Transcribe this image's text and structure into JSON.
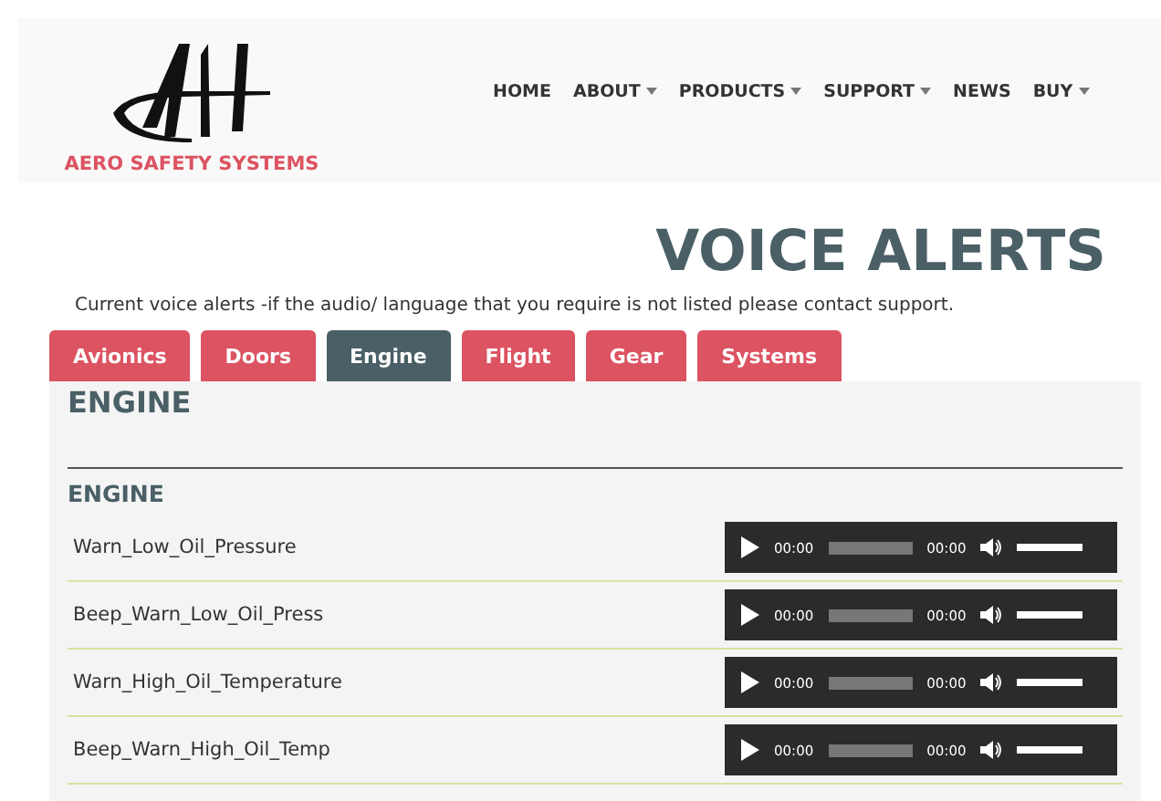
{
  "brand": {
    "name": "AERO SAFETY SYSTEMS"
  },
  "nav": [
    {
      "label": "HOME",
      "dropdown": false
    },
    {
      "label": "ABOUT",
      "dropdown": true
    },
    {
      "label": "PRODUCTS",
      "dropdown": true
    },
    {
      "label": "SUPPORT",
      "dropdown": true
    },
    {
      "label": "NEWS",
      "dropdown": false
    },
    {
      "label": "BUY",
      "dropdown": true
    }
  ],
  "page": {
    "title": "VOICE ALERTS",
    "intro": "Current voice alerts -if the audio/ language that you require is not listed please contact support."
  },
  "tabs": [
    {
      "label": "Avionics",
      "selected": false
    },
    {
      "label": "Doors",
      "selected": false
    },
    {
      "label": "Engine",
      "selected": true
    },
    {
      "label": "Flight",
      "selected": false
    },
    {
      "label": "Gear",
      "selected": false
    },
    {
      "label": "Systems",
      "selected": false
    }
  ],
  "panel": {
    "heading": "ENGINE",
    "section": "ENGINE",
    "alerts": [
      {
        "name": "Warn_Low_Oil_Pressure",
        "current": "00:00",
        "progress": {
          "level": 0
        },
        "duration": "00:00",
        "volume": {
          "level": 1
        }
      },
      {
        "name": "Beep_Warn_Low_Oil_Press",
        "current": "00:00",
        "progress": {
          "level": 0
        },
        "duration": "00:00",
        "volume": {
          "level": 1
        }
      },
      {
        "name": "Warn_High_Oil_Temperature",
        "current": "00:00",
        "progress": {
          "level": 0
        },
        "duration": "00:00",
        "volume": {
          "level": 1
        }
      },
      {
        "name": "Beep_Warn_High_Oil_Temp",
        "current": "00:00",
        "progress": {
          "level": 0
        },
        "duration": "00:00",
        "volume": {
          "level": 1
        }
      }
    ]
  }
}
